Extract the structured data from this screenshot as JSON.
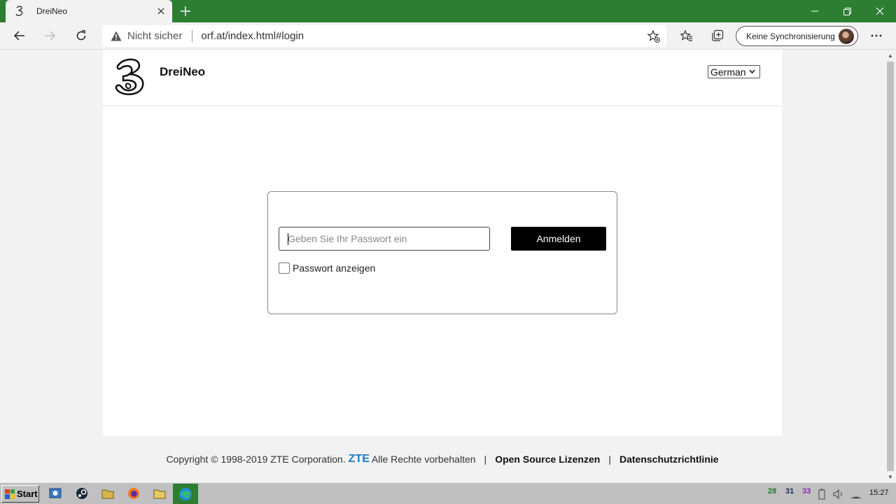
{
  "browser": {
    "tab_title": "DreiNeo",
    "not_secure": "Nicht sicher",
    "url": "orf.at/index.html#login",
    "sync_label": "Keine Synchronisierung"
  },
  "header": {
    "brand": "DreiNeo",
    "language": "German"
  },
  "login": {
    "password_placeholder": "Geben Sie Ihr Passwort ein",
    "login_button": "Anmelden",
    "show_password_label": "Passwort anzeigen"
  },
  "footer": {
    "copyright": "Copyright © 1998-2019 ZTE Corporation.",
    "zte": "ZTE",
    "rights": "Alle Rechte vorbehalten",
    "separator": "|",
    "open_source": "Open Source Lizenzen",
    "privacy": "Datenschutzrichtlinie"
  },
  "taskbar": {
    "start_label": "Start",
    "tray_items": [
      "28",
      "31",
      "33"
    ],
    "time": "15:27"
  },
  "colors": {
    "titlebar": "#2d7d33",
    "zte_blue": "#1a7bc4",
    "login_button": "#000000"
  }
}
